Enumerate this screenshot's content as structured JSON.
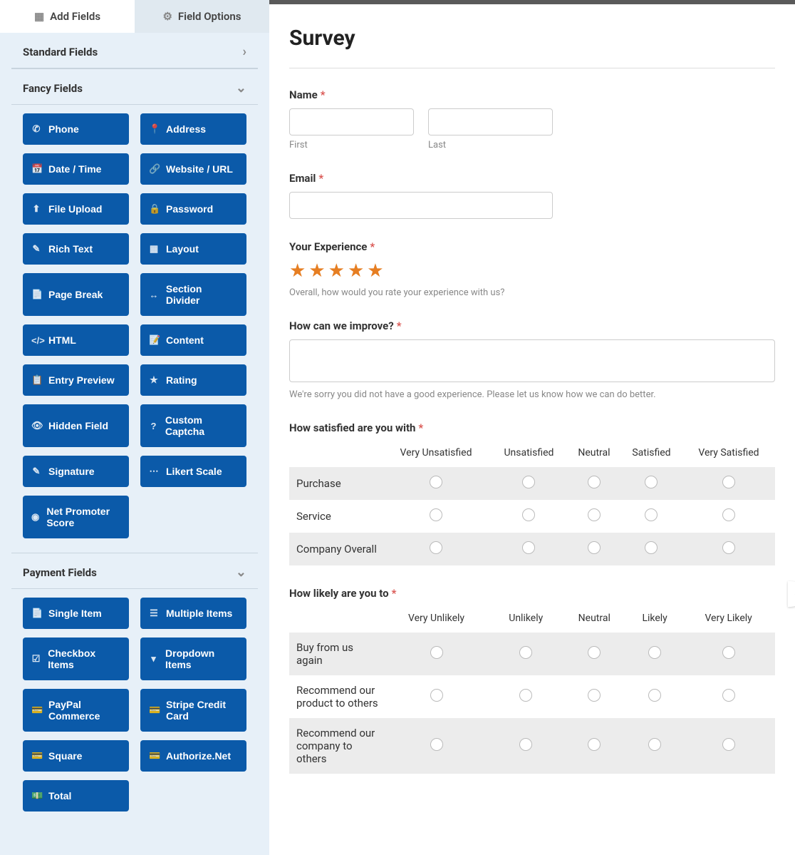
{
  "tabs": {
    "add_fields": "Add Fields",
    "field_options": "Field Options"
  },
  "sections": {
    "standard": "Standard Fields",
    "fancy": "Fancy Fields",
    "payment": "Payment Fields"
  },
  "fancy_fields": [
    {
      "icon": "phone-icon",
      "glyph": "✆",
      "label": "Phone"
    },
    {
      "icon": "address-icon",
      "glyph": "📍",
      "label": "Address"
    },
    {
      "icon": "date-icon",
      "glyph": "📅",
      "label": "Date / Time"
    },
    {
      "icon": "link-icon",
      "glyph": "🔗",
      "label": "Website / URL"
    },
    {
      "icon": "upload-icon",
      "glyph": "⬆",
      "label": "File Upload"
    },
    {
      "icon": "lock-icon",
      "glyph": "🔒",
      "label": "Password"
    },
    {
      "icon": "edit-icon",
      "glyph": "✎",
      "label": "Rich Text"
    },
    {
      "icon": "layout-icon",
      "glyph": "▦",
      "label": "Layout"
    },
    {
      "icon": "page-icon",
      "glyph": "📄",
      "label": "Page Break"
    },
    {
      "icon": "divider-icon",
      "glyph": "↔",
      "label": "Section Divider"
    },
    {
      "icon": "code-icon",
      "glyph": "</>",
      "label": "HTML"
    },
    {
      "icon": "content-icon",
      "glyph": "📝",
      "label": "Content"
    },
    {
      "icon": "preview-icon",
      "glyph": "📋",
      "label": "Entry Preview"
    },
    {
      "icon": "star-icon",
      "glyph": "★",
      "label": "Rating"
    },
    {
      "icon": "hidden-icon",
      "glyph": "👁",
      "label": "Hidden Field"
    },
    {
      "icon": "captcha-icon",
      "glyph": "?",
      "label": "Custom Captcha"
    },
    {
      "icon": "signature-icon",
      "glyph": "✎",
      "label": "Signature"
    },
    {
      "icon": "likert-icon",
      "glyph": "⋯",
      "label": "Likert Scale"
    },
    {
      "icon": "nps-icon",
      "glyph": "◉",
      "label": "Net Promoter Score"
    }
  ],
  "payment_fields": [
    {
      "icon": "single-icon",
      "glyph": "📄",
      "label": "Single Item"
    },
    {
      "icon": "multiple-icon",
      "glyph": "☰",
      "label": "Multiple Items"
    },
    {
      "icon": "checkbox-icon",
      "glyph": "☑",
      "label": "Checkbox Items"
    },
    {
      "icon": "dropdown-icon",
      "glyph": "▾",
      "label": "Dropdown Items"
    },
    {
      "icon": "card-icon",
      "glyph": "💳",
      "label": "PayPal Commerce"
    },
    {
      "icon": "card-icon",
      "glyph": "💳",
      "label": "Stripe Credit Card"
    },
    {
      "icon": "card-icon",
      "glyph": "💳",
      "label": "Square"
    },
    {
      "icon": "card-icon",
      "glyph": "💳",
      "label": "Authorize.Net"
    },
    {
      "icon": "money-icon",
      "glyph": "💵",
      "label": "Total"
    }
  ],
  "form": {
    "title": "Survey",
    "name": {
      "label": "Name",
      "first": "First",
      "last": "Last"
    },
    "email": {
      "label": "Email"
    },
    "experience": {
      "label": "Your Experience",
      "rating": 5,
      "hint": "Overall, how would you rate your experience with us?"
    },
    "improve": {
      "label": "How can we improve?",
      "hint": "We're sorry you did not have a good experience. Please let us know how we can do better."
    },
    "satisfied": {
      "label": "How satisfied are you with",
      "cols": [
        "Very Unsatisfied",
        "Unsatisfied",
        "Neutral",
        "Satisfied",
        "Very Satisfied"
      ],
      "rows": [
        "Purchase",
        "Service",
        "Company Overall"
      ]
    },
    "likely": {
      "label": "How likely are you to",
      "cols": [
        "Very Unlikely",
        "Unlikely",
        "Neutral",
        "Likely",
        "Very Likely"
      ],
      "rows": [
        "Buy from us again",
        "Recommend our product to others",
        "Recommend our company to others"
      ]
    }
  }
}
